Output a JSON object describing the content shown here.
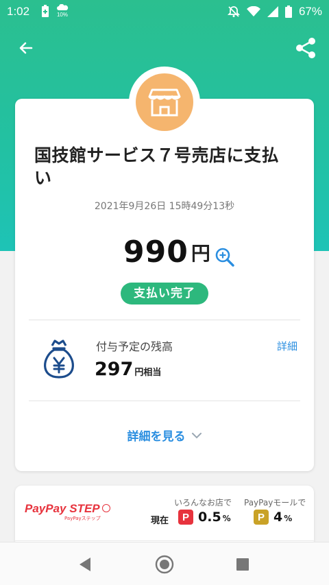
{
  "status_bar": {
    "time": "1:02",
    "weather_text": "10%",
    "battery": "67%"
  },
  "merchant": {
    "name": "国技館サービス７号売店に支払い",
    "datetime": "2021年9月26日 15時49分13秒"
  },
  "payment": {
    "amount": "990",
    "currency": "円",
    "status": "支払い完了"
  },
  "reward": {
    "label": "付与予定の残高",
    "value": "297",
    "unit": "円相当",
    "detail_link": "詳細"
  },
  "more_link": "詳細を見る",
  "step": {
    "brand": "PayPay STEP",
    "brand_sub": "PayPayステップ",
    "col_shops": "いろんなお店で",
    "col_mall": "PayPayモールで",
    "now_label": "現在",
    "shops_rate": "0.5",
    "mall_rate": "4",
    "percent": "%",
    "badge_letter": "P"
  },
  "colors": {
    "hero_top": "#2bbf8f",
    "hero_bottom": "#1ec3b6",
    "shop_icon_bg": "#f5b56e",
    "status_pill": "#2db87d",
    "link": "#2a8ee0",
    "paypay_red": "#e7333d",
    "mall_gold": "#c9a227"
  },
  "icons": {
    "back": "arrow-left-icon",
    "share": "share-icon",
    "shop": "storefront-icon",
    "zoom": "zoom-in-icon",
    "reward": "money-bag-icon",
    "chevron": "chevron-down-icon"
  }
}
